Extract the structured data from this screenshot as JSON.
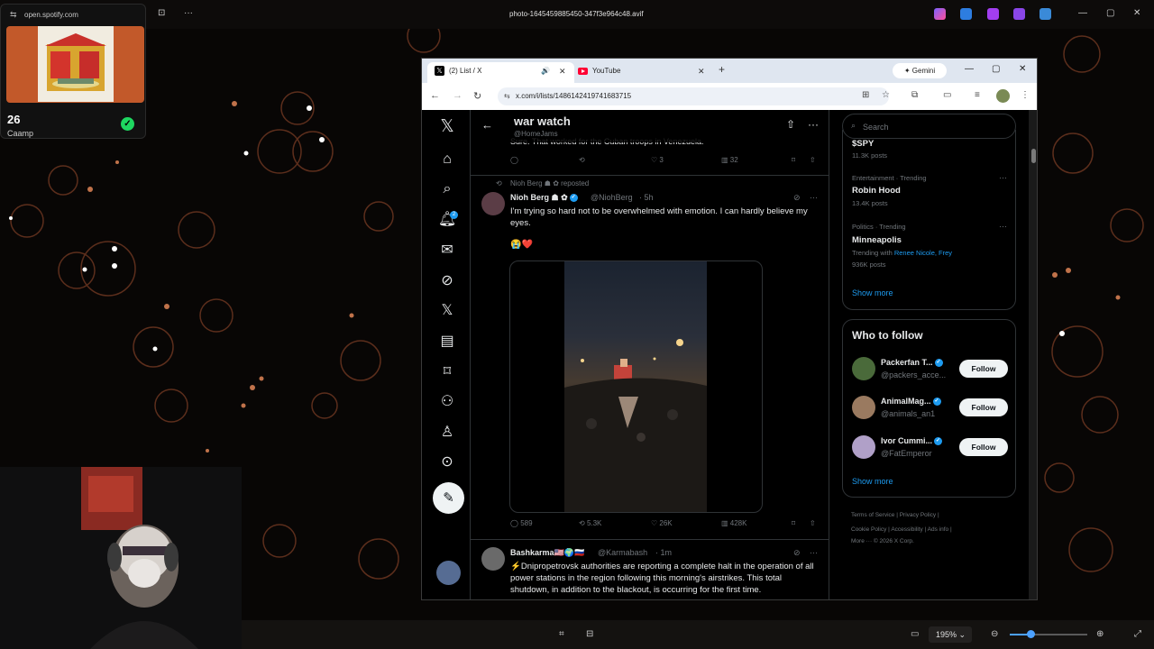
{
  "viewer": {
    "title": "photo-1645459885450-347f3e964c48.avif",
    "zoom": "195%",
    "accent_color": "#4ca1ff"
  },
  "spotify": {
    "url": "open.spotify.com",
    "count": "26",
    "name": "Caamp",
    "check_icon": "check-icon"
  },
  "browser": {
    "tabs": [
      {
        "label": "(2) List / X",
        "icon": "x-logo-icon"
      },
      {
        "label": "YouTube",
        "icon": "youtube-icon"
      }
    ],
    "gemini_label": "Gemini",
    "url": "x.com/i/lists/1486142419741683715"
  },
  "x": {
    "list": {
      "title": "war watch",
      "handle": "@HomeJams"
    },
    "prev_post": {
      "text": "Sure. That worked for the Cuban troops in Venezuela.",
      "likes": "3",
      "views": "32"
    },
    "post": {
      "repost_label": "Nioh Berg ☗ ✿ reposted",
      "name": "Nioh Berg ☗ ✿",
      "handle": "@NiohBerg",
      "time": "· 5h",
      "text": "I'm trying so hard not to be overwhelmed with emotion. I can hardly believe my eyes.",
      "emoji": "😭❤️",
      "replies": "589",
      "reposts": "5.3K",
      "likes": "26K",
      "views": "428K"
    },
    "post2": {
      "name": "Bashkarma🇺🇸🌍🇷🇺",
      "handle": "@Karmabash",
      "time": "· 1m",
      "text": "⚡Dnipropetrovsk authorities are reporting a complete halt in the operation of all power stations in the region following this morning's airstrikes. This total shutdown, in addition to the blackout, is occurring for the first time."
    },
    "search_placeholder": "Search",
    "trends": [
      {
        "meta": "",
        "title": "$SPY",
        "posts": "11.3K posts"
      },
      {
        "meta": "Entertainment · Trending",
        "title": "Robin Hood",
        "posts": "13.4K posts"
      },
      {
        "meta": "Politics · Trending",
        "title": "Minneapolis",
        "trending_with_label": "Trending with",
        "trending_with": "Renee Nicole, Frey",
        "posts": "936K posts"
      }
    ],
    "trends_show_more": "Show more",
    "who_to_follow": {
      "title": "Who to follow",
      "accounts": [
        {
          "name": "Packerfan T...",
          "handle": "@packers_acce...",
          "button": "Follow"
        },
        {
          "name": "AnimalMag...",
          "handle": "@animals_an1",
          "button": "Follow"
        },
        {
          "name": "Ivor Cummi...",
          "handle": "@FatEmperor",
          "button": "Follow"
        }
      ],
      "show_more": "Show more"
    },
    "footer": {
      "line1": "Terms of Service  |  Privacy Policy  |",
      "line2": "Cookie Policy  |  Accessibility  |  Ads info  |",
      "line3": "More ···   © 2026 X Corp."
    }
  }
}
